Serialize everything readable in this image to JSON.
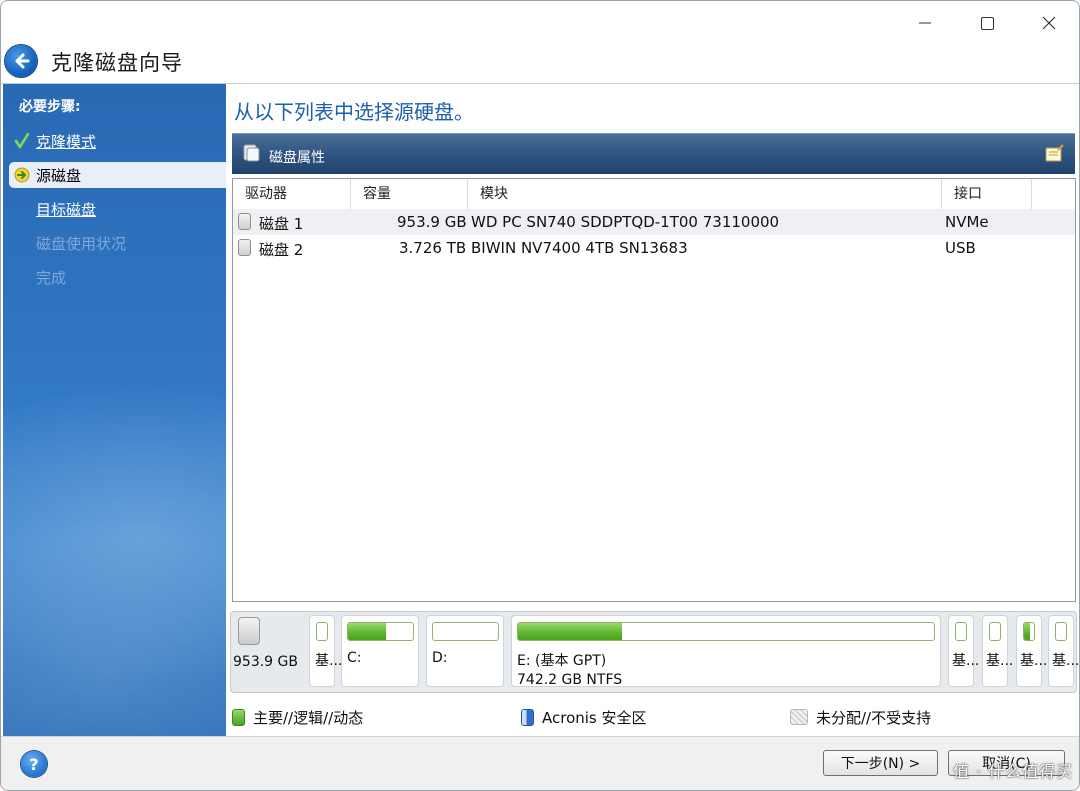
{
  "window": {
    "title": "克隆磁盘向导",
    "controls": [
      "minimize",
      "maximize",
      "close"
    ]
  },
  "sidebar": {
    "heading": "必要步骤:",
    "steps": [
      {
        "label": "克隆模式",
        "state": "done"
      },
      {
        "label": "源磁盘",
        "state": "current"
      },
      {
        "label": "目标磁盘",
        "state": "todo"
      },
      {
        "label": "磁盘使用状况",
        "state": "disabled"
      },
      {
        "label": "完成",
        "state": "disabled"
      }
    ]
  },
  "main": {
    "title": "从以下列表中选择源硬盘。",
    "properties_label": "磁盘属性",
    "columns": [
      "驱动器",
      "容量",
      "模块",
      "接口"
    ],
    "disks": [
      {
        "drive": "磁盘 1",
        "capacity": "953.9 GB",
        "model": "WD PC SN740 SDDPTQD-1T00 73110000",
        "interface": "NVMe",
        "selected": true
      },
      {
        "drive": "磁盘 2",
        "capacity": "3.726 TB",
        "model": "BIWIN NV7400 4TB SN13683",
        "interface": "USB",
        "selected": false
      }
    ]
  },
  "partition_map": {
    "disk_size": "953.9 GB",
    "partitions": [
      {
        "label": "基...",
        "kind": "small",
        "fill": 0
      },
      {
        "label": "C:",
        "kind": "wide",
        "fill": 0.58
      },
      {
        "label": "D:",
        "kind": "wide",
        "fill": 0
      },
      {
        "label": "E: (基本 GPT)",
        "detail": "742.2 GB  NTFS",
        "kind": "wide",
        "fill": 0.25
      },
      {
        "label": "基...",
        "kind": "small",
        "fill": 0
      },
      {
        "label": "基...",
        "kind": "small",
        "fill": 0
      },
      {
        "label": "基...",
        "kind": "small",
        "fill": 0.6
      },
      {
        "label": "基...",
        "kind": "small",
        "fill": 0
      }
    ]
  },
  "legend": [
    {
      "label": "主要//逻辑//动态",
      "color": "#5bb52c"
    },
    {
      "label": "Acronis 安全区",
      "color": "#2f6fd0"
    },
    {
      "label": "未分配//不受支持",
      "color": "#cfcfcf"
    }
  ],
  "buttons": {
    "help": "?",
    "next": "下一步(N) >",
    "cancel": "取消(C)"
  },
  "watermark": "值 · 什么值得买"
}
